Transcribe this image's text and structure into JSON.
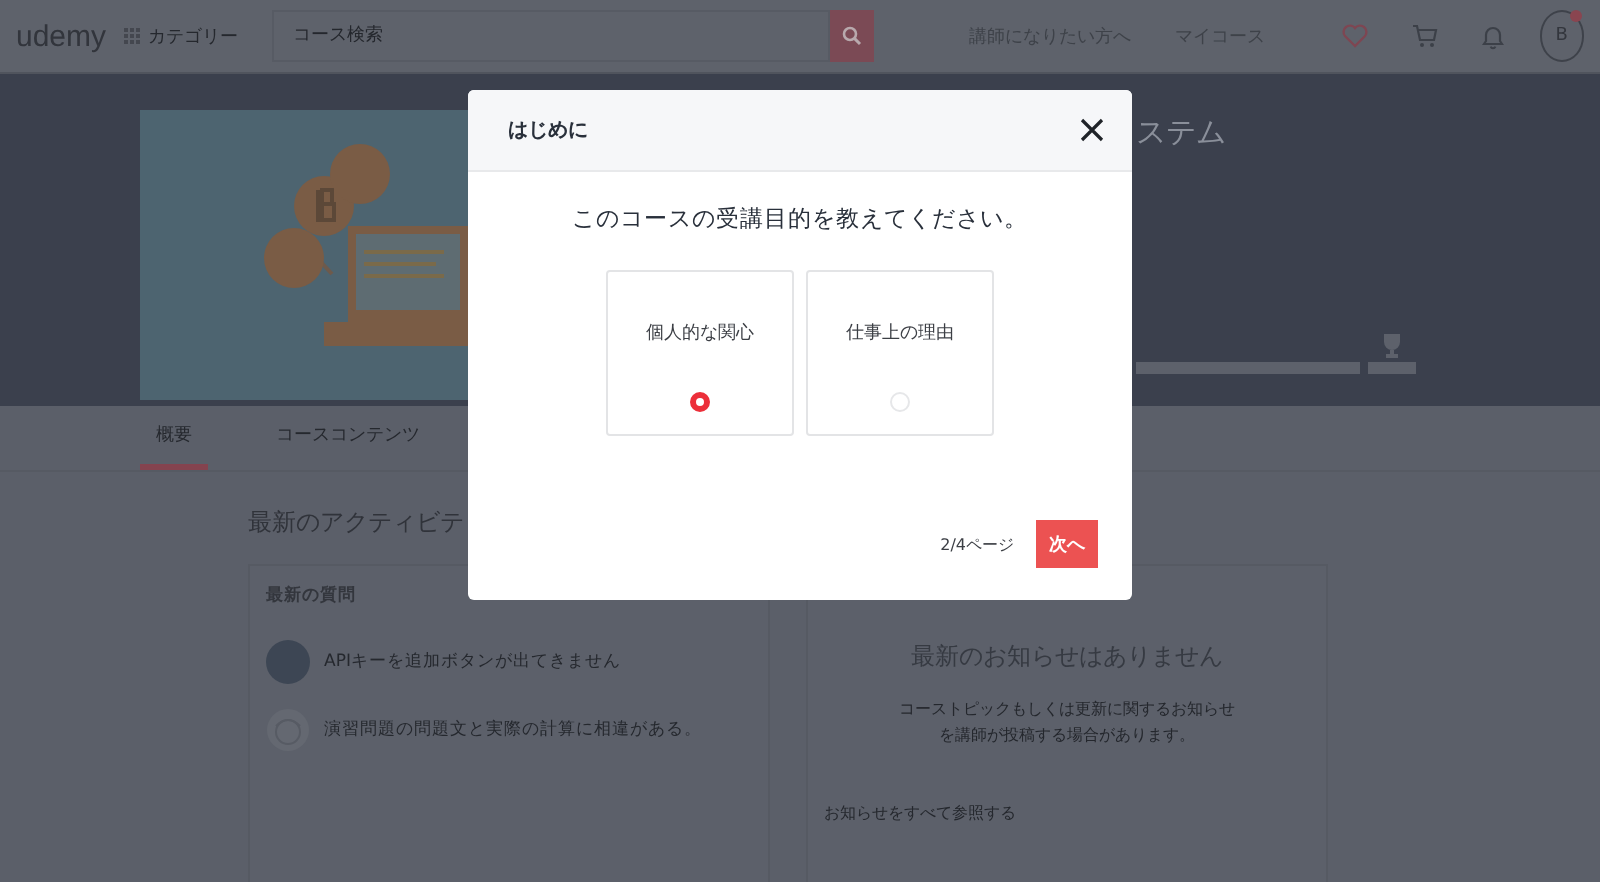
{
  "header": {
    "logo": "udemy",
    "category_menu": "カテゴリー",
    "search": {
      "placeholder": "コース検索"
    },
    "links": [
      "講師になりたい方へ",
      "マイコース"
    ],
    "avatar": {
      "initial": "B",
      "notification": true
    }
  },
  "course": {
    "title": "ステム"
  },
  "tabs": [
    {
      "label": "概要",
      "selected": true
    },
    {
      "label": "コースコンテンツ",
      "selected": false
    }
  ],
  "activity": {
    "heading": "最新のアクティビテ",
    "questions_card": {
      "title": "最新の質問",
      "items": [
        {
          "text": "APIキーを追加ボタンが出てきません",
          "kind": "photo"
        },
        {
          "text": "演習問題の問題文と実際の計算に相違がある。",
          "kind": "default"
        }
      ]
    },
    "announcements_card": {
      "title": "最新のお知らせはありません",
      "description": "コーストピックもしくは更新に関するお知らせを講師が投稿する場合があります。",
      "link": "お知らせをすべて参照する"
    }
  },
  "modal": {
    "title": "はじめに",
    "question": "このコースの受講目的を教えてください。",
    "options": [
      {
        "label": "個人的な関心",
        "selected": true
      },
      {
        "label": "仕事上の理由",
        "selected": false
      }
    ],
    "page": "2/4ページ",
    "next_button": "次へ"
  }
}
